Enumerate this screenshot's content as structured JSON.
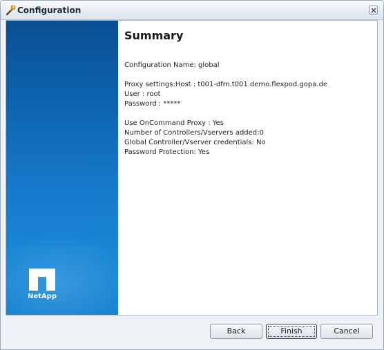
{
  "window": {
    "title": "Configuration",
    "icon": "wrench-icon",
    "close_icon": "close-icon"
  },
  "banner": {
    "logo_text": "NetApp",
    "logo_icon": "netapp-logo-icon",
    "color_top": "#0a4f93",
    "color_bottom": "#1782cf"
  },
  "summary": {
    "heading": "Summary",
    "lines": [
      "Configuration Name: global",
      "Proxy settings:Host : t001-dfm.t001.demo.flexpod.gopa.de",
      "User : root",
      "Password : *****",
      "Use OnCommand Proxy : Yes",
      "Number of Controllers/Vservers added:0",
      "Global Controller/Vserver credentials: No",
      "Password Protection: Yes"
    ]
  },
  "buttons": {
    "back": "Back",
    "finish": "Finish",
    "cancel": "Cancel"
  }
}
